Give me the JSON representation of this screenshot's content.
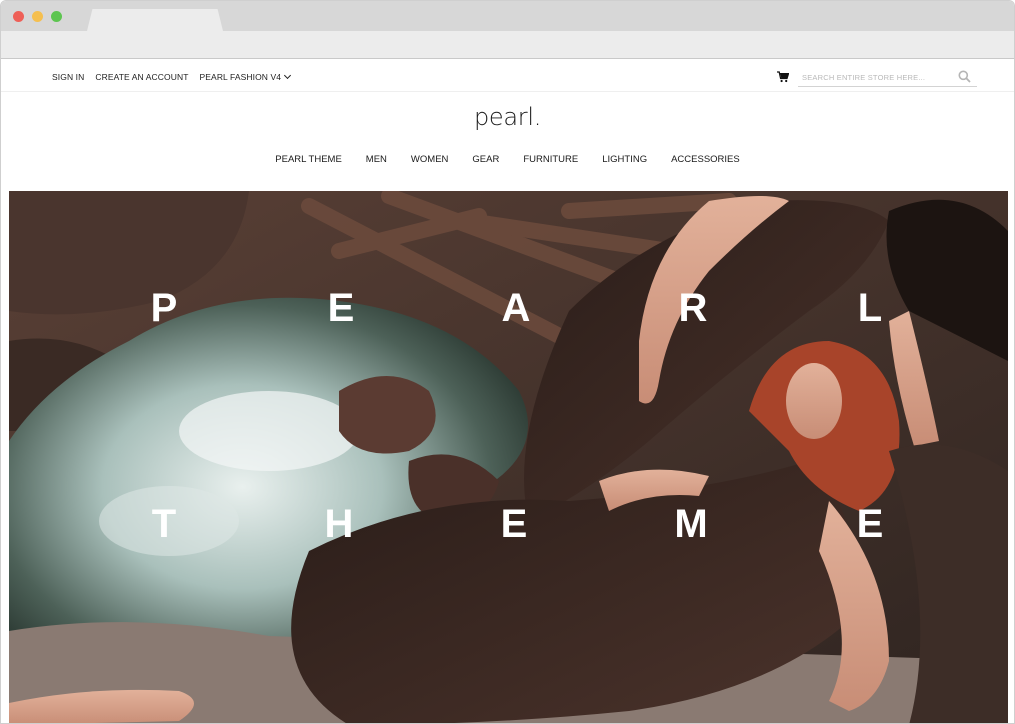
{
  "browser": {
    "traffic_lights": {
      "close": "#ee5f57",
      "minimize": "#f5bf4f",
      "maximize": "#5dc550"
    }
  },
  "topbar": {
    "links": [
      "SIGN IN",
      "CREATE AN ACCOUNT",
      "PEARL FASHION V4"
    ],
    "cart_icon": "cart-icon",
    "search": {
      "placeholder": "SEARCH ENTIRE STORE HERE...",
      "value": "",
      "icon": "search-icon"
    }
  },
  "logo": "pearl.",
  "nav": [
    "PEARL THEME",
    "MEN",
    "WOMEN",
    "GEAR",
    "FURNITURE",
    "LIGHTING",
    "ACCESSORIES"
  ],
  "hero": {
    "line1": [
      "P",
      "E",
      "A",
      "R",
      "L"
    ],
    "line2": [
      "T",
      "H",
      "E",
      "M",
      "E"
    ]
  }
}
